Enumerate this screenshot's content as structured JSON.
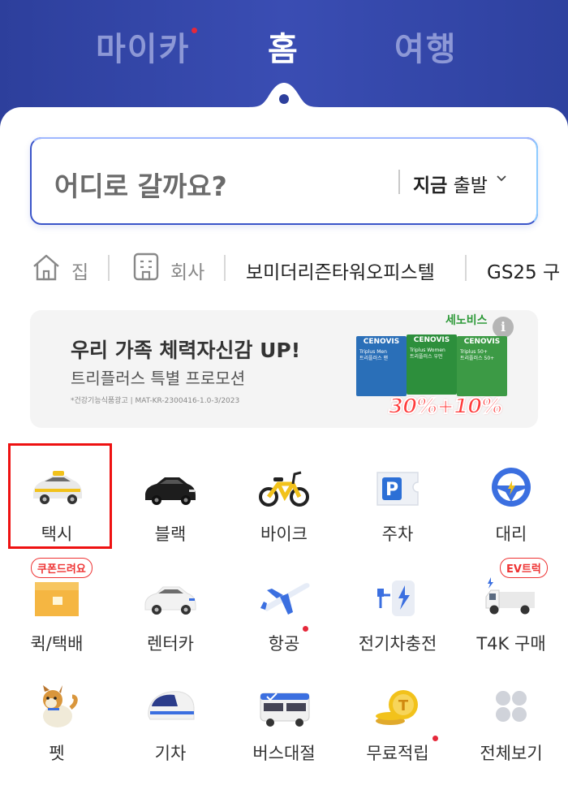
{
  "header": {
    "tabs": [
      {
        "label": "마이카",
        "has_dot": true
      },
      {
        "label": "홈",
        "active": true
      },
      {
        "label": "여행"
      }
    ]
  },
  "search": {
    "placeholder": "어디로 갈까요?",
    "depart_bold": "지금",
    "depart_rest": "출발"
  },
  "places": [
    {
      "label": "집",
      "icon": "home-icon"
    },
    {
      "label": "회사",
      "icon": "building-icon"
    },
    {
      "label": "보미더리즌타워오피스텔"
    },
    {
      "label": "GS25 구"
    }
  ],
  "banner": {
    "title": "우리 가족 체력자신감 UP!",
    "subtitle": "트리플러스 특별 프로모션",
    "fine_print": "*건강기능식품광고 | MAT-KR-2300416-1.0-3/2023",
    "brand": "세노비스",
    "info": "i",
    "products": [
      {
        "brand": "CENOVIS",
        "name": "Triplus Men",
        "sub": "트리플러스 맨",
        "color": "#2a6fb8"
      },
      {
        "brand": "CENOVIS",
        "name": "Triplus Women",
        "sub": "트리플러스 우먼",
        "color": "#2d8f3c"
      },
      {
        "brand": "CENOVIS",
        "name": "Triplus 50+",
        "sub": "트리플러스 50+",
        "color": "#3c9a45"
      }
    ],
    "promo": "30%+10%"
  },
  "services": [
    {
      "label": "택시",
      "icon": "taxi-icon"
    },
    {
      "label": "블랙",
      "icon": "black-car-icon"
    },
    {
      "label": "바이크",
      "icon": "bike-icon"
    },
    {
      "label": "주차",
      "icon": "parking-icon"
    },
    {
      "label": "대리",
      "icon": "steering-wheel-icon"
    },
    {
      "label": "퀵/택배",
      "icon": "parcel-box-icon",
      "badge": "쿠폰드려요"
    },
    {
      "label": "렌터카",
      "icon": "rental-car-icon"
    },
    {
      "label": "항공",
      "icon": "airplane-icon",
      "has_dot": true
    },
    {
      "label": "전기차충전",
      "icon": "ev-charger-icon"
    },
    {
      "label": "T4K 구매",
      "icon": "truck-icon",
      "badge": "EV트럭"
    },
    {
      "label": "펫",
      "icon": "dog-icon"
    },
    {
      "label": "기차",
      "icon": "train-icon"
    },
    {
      "label": "버스대절",
      "icon": "bus-icon"
    },
    {
      "label": "무료적립",
      "icon": "coin-icon",
      "has_dot": true
    },
    {
      "label": "전체보기",
      "icon": "grid-dots-icon"
    }
  ],
  "colors": {
    "header_bg": "#3a4db3",
    "accent_red": "#e5283a",
    "highlight": "#ee1111"
  }
}
